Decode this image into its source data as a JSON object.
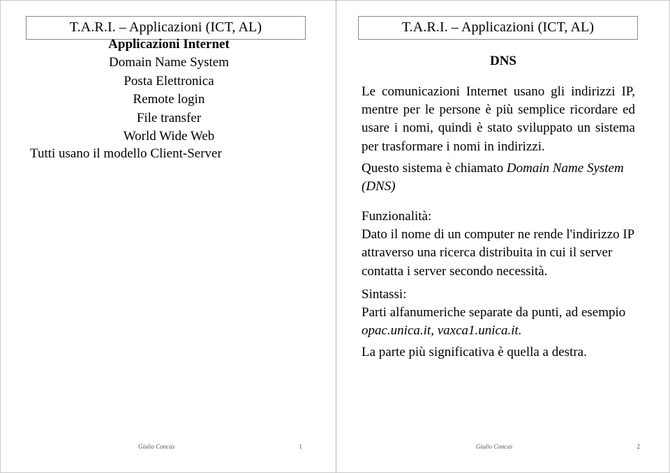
{
  "document": {
    "type": "slide-handout",
    "background_color": "#ffffff",
    "text_color": "#000000",
    "panel_border_color": "#c8c8c8"
  },
  "slides": [
    {
      "number": "1",
      "header_title": "T.A.R.I. – Applicazioni (ICT, AL)",
      "list_heading": "Applicazioni Internet",
      "list_items": [
        "Domain Name System",
        "Posta Elettronica",
        "Remote login",
        "File transfer",
        "World Wide Web"
      ],
      "closing_line": "Tutti usano il modello Client-Server",
      "footer_author": "Giulio Concas",
      "footer_page": "1"
    },
    {
      "number": "2",
      "header_title": "T.A.R.I. – Applicazioni (ICT, AL)",
      "heading": "DNS",
      "paragraph_1": "Le comunicazioni Internet usano gli indirizzi IP, mentre per le persone è più semplice ricordare ed usare i nomi, quindi è stato sviluppato un sistema per trasformare i nomi in indirizzi.",
      "paragraph_2_prefix": "Questo sistema è chiamato ",
      "paragraph_2_italic": "Domain Name System (DNS)",
      "functionality_label": "Funzionalità:",
      "functionality_text": "Dato il nome di un computer ne rende l'indirizzo IP attraverso una ricerca distribuita in cui il server contatta i server secondo necessità.",
      "syntax_label": "Sintassi:",
      "syntax_text": "Parti alfanumeriche separate da punti, ad esempio ",
      "syntax_italic": "opac.unica.it, vaxca1.unica.it.",
      "final_line": "La parte più significativa è quella a destra.",
      "footer_author": "Giulio Concas",
      "footer_page": "2"
    }
  ]
}
